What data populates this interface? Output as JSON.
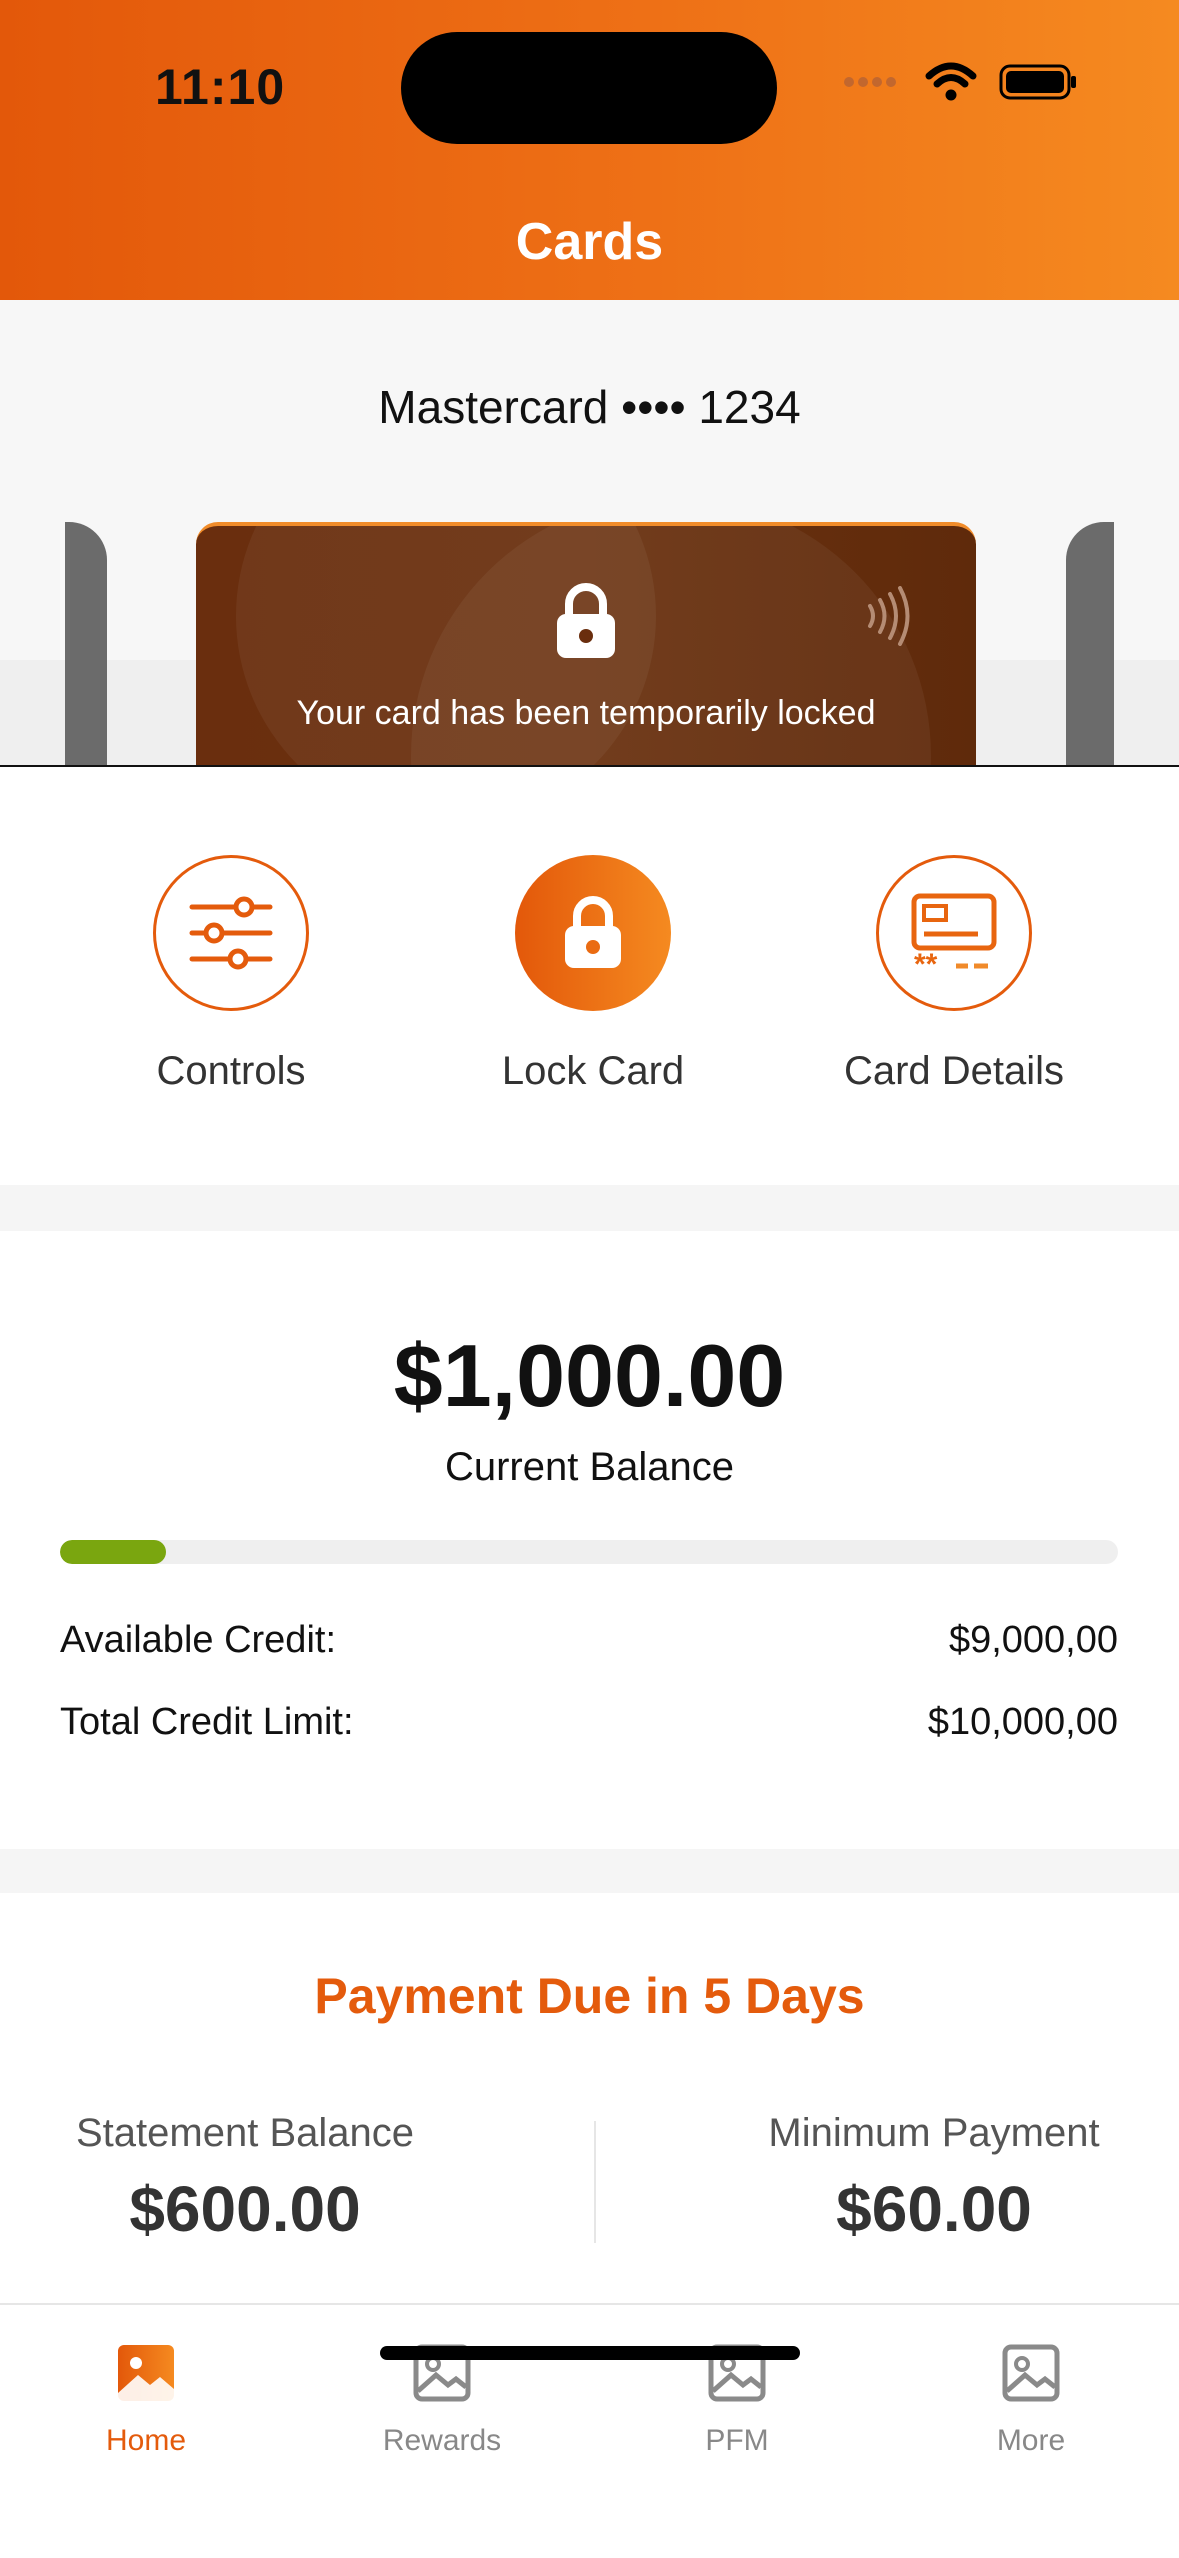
{
  "status_bar": {
    "time": "11:10"
  },
  "header": {
    "title": "Cards"
  },
  "card": {
    "name": "Mastercard •••• 1234",
    "locked_message": "Your card has been temporarily locked"
  },
  "actions": [
    {
      "label": "Controls",
      "icon": "sliders-icon"
    },
    {
      "label": "Lock Card",
      "icon": "lock-icon"
    },
    {
      "label": "Card Details",
      "icon": "card-details-icon"
    }
  ],
  "balance": {
    "amount": "$1,000.00",
    "label": "Current Balance",
    "utilization_fraction": 0.1,
    "available_credit_label": "Available Credit:",
    "available_credit_value": "$9,000,00",
    "total_limit_label": "Total Credit Limit:",
    "total_limit_value": "$10,000,00"
  },
  "payment": {
    "title": "Payment Due in 5 Days",
    "statement_label": "Statement Balance",
    "statement_value": "$600.00",
    "minimum_label": "Minimum Payment",
    "minimum_value": "$60.00"
  },
  "tabs": [
    {
      "label": "Home",
      "active": true
    },
    {
      "label": "Rewards",
      "active": false
    },
    {
      "label": "PFM",
      "active": false
    },
    {
      "label": "More",
      "active": false
    }
  ],
  "colors": {
    "accent": "#e45b0c",
    "progress": "#7aa60f",
    "card": "#6a2e0e"
  }
}
